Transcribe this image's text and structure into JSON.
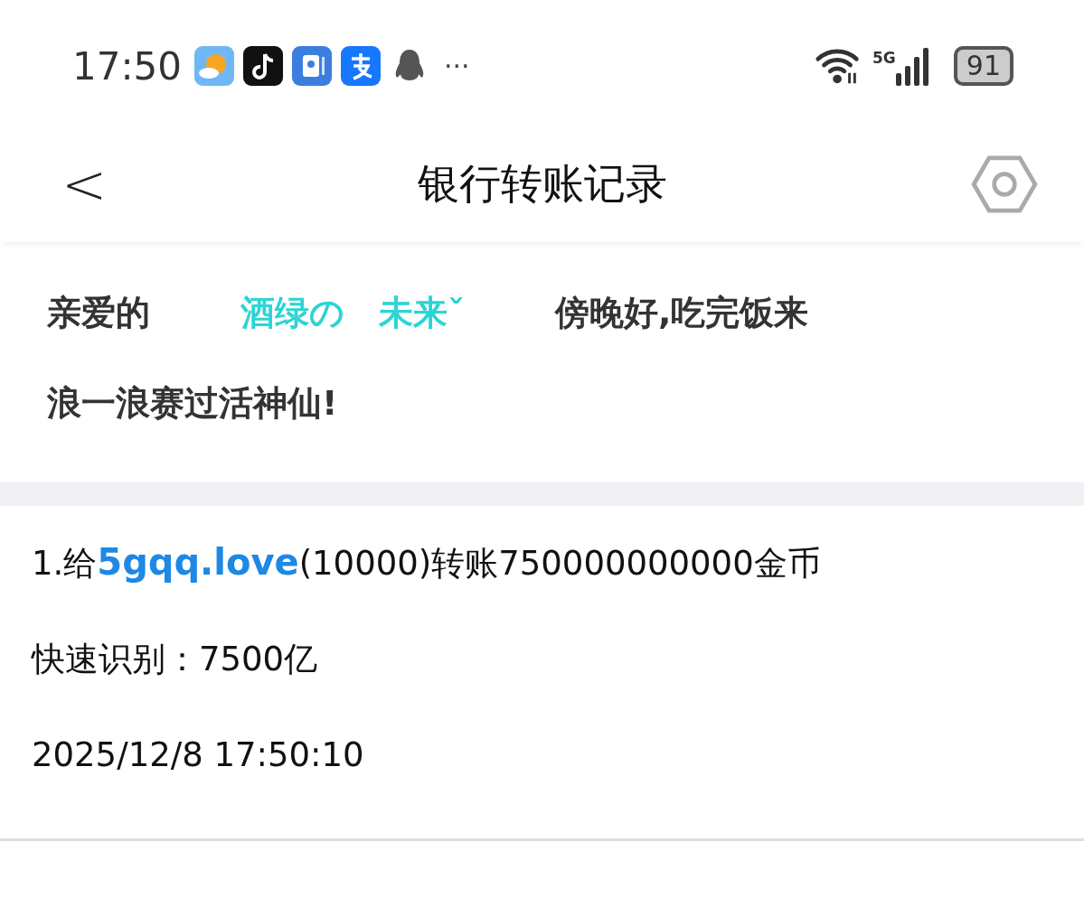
{
  "status_bar": {
    "time": "17:50",
    "more": "···",
    "network": "5G",
    "battery": "91"
  },
  "header": {
    "back": "<",
    "title": "银行转账记录"
  },
  "greeting": [
    [
      {
        "kind": "plain",
        "text": "亲爱的"
      },
      {
        "kind": "name",
        "text": "酒绿の　未来ˇ"
      },
      {
        "kind": "plain",
        "text": "傍晚好,吃完饭来"
      }
    ],
    [
      {
        "kind": "plain",
        "text": "浪一浪赛过活神仙!"
      }
    ]
  ],
  "records": [
    {
      "line": [
        {
          "kind": "plain",
          "text": "1.给"
        },
        {
          "kind": "name",
          "text": "5gqq.love"
        },
        {
          "kind": "plain",
          "text": "(10000)转账750000000000金币"
        }
      ],
      "quick": "快速识别：7500亿",
      "time": "2025/12/8 17:50:10"
    }
  ]
}
